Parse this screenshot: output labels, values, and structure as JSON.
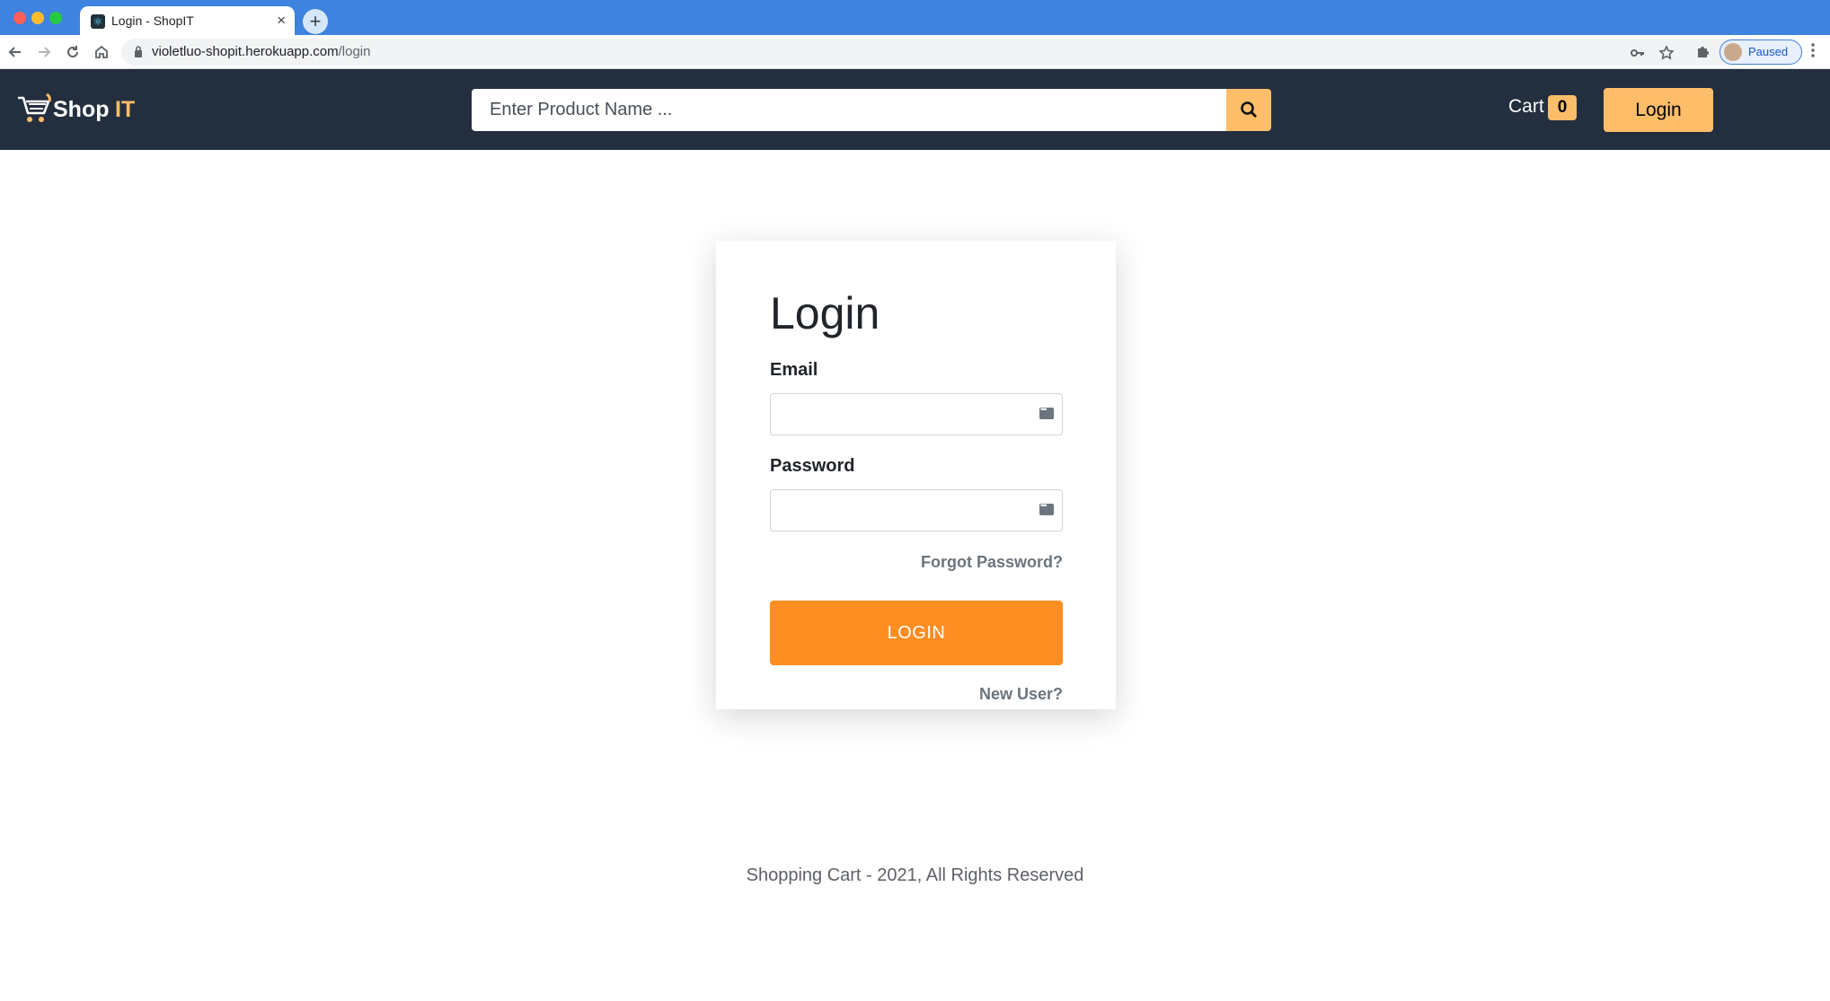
{
  "browser": {
    "tab_title": "Login - ShopIT",
    "tab_close": "×",
    "new_tab": "+",
    "url_host": "violetluo-shopit.herokuapp.com",
    "url_path": "/login",
    "profile_label": "Paused"
  },
  "header": {
    "logo_shop": "Shop",
    "logo_it": "IT",
    "search_placeholder": "Enter Product Name ...",
    "cart_label": "Cart",
    "cart_count": "0",
    "login_label": "Login"
  },
  "login_form": {
    "heading": "Login",
    "email_label": "Email",
    "email_value": "",
    "password_label": "Password",
    "password_value": "",
    "forgot_link": "Forgot Password?",
    "submit_label": "LOGIN",
    "new_user_link": "New User?"
  },
  "footer": {
    "text": "Shopping Cart - 2021, All Rights Reserved"
  },
  "colors": {
    "nav_background": "#232f3e",
    "accent": "#febd69",
    "login_button": "#fe8d22",
    "browser_tabstrip": "#3d83df"
  },
  "icons": {
    "back": "arrow-left-icon",
    "forward": "arrow-right-icon",
    "reload": "reload-icon",
    "home": "home-icon",
    "lock": "lock-icon",
    "key": "key-icon",
    "star": "star-icon",
    "extensions": "puzzle-icon",
    "menu": "kebab-menu-icon",
    "search": "search-icon",
    "cart_logo": "shopping-cart-icon",
    "autofill": "autofill-key-icon"
  }
}
